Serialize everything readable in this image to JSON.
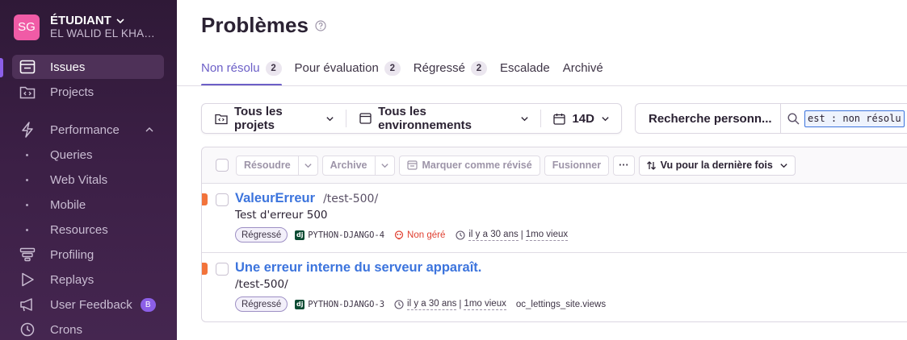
{
  "sidebar": {
    "org": {
      "avatar": "SG",
      "name": "ÉTUDIANT",
      "user": "EL WALID EL KHAB..."
    },
    "items": [
      {
        "label": "Issues",
        "icon": "issues-icon",
        "active": true
      },
      {
        "label": "Projects",
        "icon": "projects-icon"
      },
      {
        "label": "Performance",
        "icon": "performance-icon"
      },
      {
        "label": "Queries",
        "sub": true
      },
      {
        "label": "Web Vitals",
        "sub": true
      },
      {
        "label": "Mobile",
        "sub": true
      },
      {
        "label": "Resources",
        "sub": true
      },
      {
        "label": "Profiling",
        "icon": "profiling-icon"
      },
      {
        "label": "Replays",
        "icon": "replays-icon"
      },
      {
        "label": "User Feedback",
        "icon": "user-feedback-icon",
        "badge": "B"
      },
      {
        "label": "Crons",
        "icon": "crons-icon"
      }
    ]
  },
  "header": {
    "title": "Problèmes",
    "tabs": [
      {
        "label": "Non résolu",
        "count": "2"
      },
      {
        "label": "Pour évaluation",
        "count": "2"
      },
      {
        "label": "Régressé",
        "count": "2"
      },
      {
        "label": "Escalade"
      },
      {
        "label": "Archivé"
      }
    ]
  },
  "filters": {
    "projects": "Tous les projets",
    "environments": "Tous les environnements",
    "period": "14D",
    "saved_search": "Recherche personn...",
    "query": "est : non résolu"
  },
  "actions": {
    "resolve": "Résoudre",
    "archive": "Archive",
    "mark_reviewed": "Marquer comme révisé",
    "merge": "Fusionner",
    "more": "···",
    "sort": "Vu pour la dernière fois"
  },
  "issues": [
    {
      "type": "ValeurErreur",
      "location": "/test-500/",
      "message": "Test d'erreur 500",
      "status": "Régressé",
      "project": "PYTHON-DJANGO-4",
      "unhandled": "Non géré",
      "age": "il y a 30 ans",
      "first_seen": "1mo vieux",
      "culprit": ""
    },
    {
      "type": "Une erreur interne du serveur apparaît.",
      "location": "",
      "message": "/test-500/",
      "status": "Régressé",
      "project": "PYTHON-DJANGO-3",
      "unhandled": "",
      "age": "il y a 30 ans",
      "first_seen": "1mo vieux",
      "culprit": "oc_lettings_site.views"
    }
  ],
  "colors": {
    "accent": "#6c5fc7",
    "link": "#3c74dd",
    "error": "#f2733b",
    "sidebar": "#3b1f45"
  }
}
